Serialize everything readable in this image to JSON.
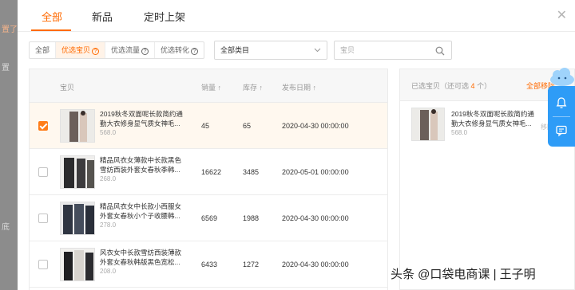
{
  "tabs": [
    "全部",
    "新品",
    "定时上架"
  ],
  "filters": {
    "segments": [
      "全部",
      "优选宝贝",
      "优选流量",
      "优选转化"
    ],
    "category": "全部类目",
    "search_placeholder": "宝贝"
  },
  "table": {
    "headers": [
      "宝贝",
      "销量 ↑",
      "库存 ↑",
      "发布日期 ↑"
    ],
    "rows": [
      {
        "name": "2019秋冬双面呢长款简约通勤大衣修身显气质女神毛...",
        "price": "568.0",
        "sales": "45",
        "stock": "65",
        "date": "2020-04-30 00:00:00",
        "checked": true
      },
      {
        "name": "精品风衣女薄款中长款黑色雪纺西装外套女春秋季韩...",
        "price": "268.0",
        "sales": "16622",
        "stock": "3485",
        "date": "2020-05-01 00:00:00",
        "checked": false
      },
      {
        "name": "精品风衣女中长款小西服女外套女春秋小个子收腰韩...",
        "price": "278.0",
        "sales": "6569",
        "stock": "1988",
        "date": "2020-04-30 00:00:00",
        "checked": false
      },
      {
        "name": "风衣女中长款雪纺西装薄款外套女春秋韩版黑色宽松...",
        "price": "208.0",
        "sales": "6433",
        "stock": "1272",
        "date": "2020-04-30 00:00:00",
        "checked": false
      }
    ]
  },
  "selected_panel": {
    "title_prefix": "已选宝贝（还可选",
    "remaining": "4",
    "title_suffix": "个）",
    "clear_all": "全部移除",
    "item": {
      "name": "2019秋冬双面呢长款简约通勤大衣修身显气质女神毛...",
      "price": "568.0",
      "remove": "移除"
    }
  },
  "background_fragments": [
    "置了",
    "置",
    "底"
  ],
  "watermark": "头条 @口袋电商课 | 王子明",
  "colors": {
    "accent": "#ff6a00",
    "float": "#2e9cf7"
  },
  "icons": [
    "close-icon",
    "help-icon",
    "chevron-down-icon",
    "search-icon",
    "checkbox",
    "bell-icon",
    "chat-icon",
    "cloud-mascot-icon"
  ]
}
